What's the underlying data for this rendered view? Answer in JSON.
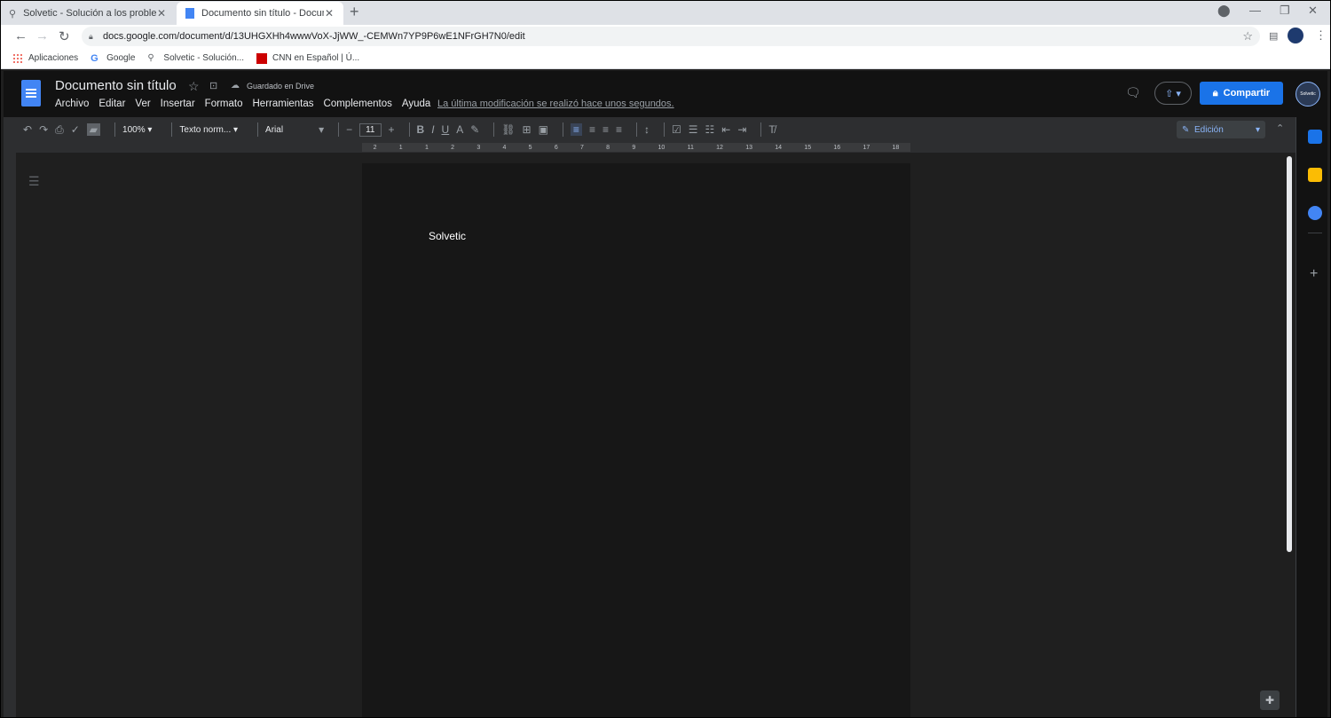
{
  "browser": {
    "tabs": [
      {
        "title": "Solvetic - Solución a los problem",
        "close": "✕"
      },
      {
        "title": "Documento sin título - Documen",
        "close": "✕"
      }
    ],
    "new_tab": "+",
    "url": "docs.google.com/document/d/13UHGXHh4wwwVoX-JjWW_-CEMWn7YP9P6wE1NFrGH7N0/edit",
    "bookmarks": [
      "Aplicaciones",
      "Google",
      "Solvetic - Solución...",
      "CNN en Español | Ú..."
    ]
  },
  "docs": {
    "title": "Documento sin título",
    "saved_status": "Guardado en Drive",
    "menus": [
      "Archivo",
      "Editar",
      "Ver",
      "Insertar",
      "Formato",
      "Herramientas",
      "Complementos",
      "Ayuda"
    ],
    "last_modified": "La última modificación se realizó hace unos segundos.",
    "share_label": "Compartir",
    "avatar_text": "Solvetic",
    "toolbar": {
      "zoom": "100%",
      "style": "Texto norm...",
      "font": "Arial",
      "font_size": "11",
      "mode": "Edición"
    },
    "ruler_marks": [
      "2",
      "1",
      "1",
      "2",
      "3",
      "4",
      "5",
      "6",
      "7",
      "8",
      "9",
      "10",
      "11",
      "12",
      "13",
      "14",
      "15",
      "16",
      "17",
      "18"
    ],
    "body_text": "Solvetic"
  },
  "colors": {
    "accent": "#1a73e8",
    "page_bg": "#171717",
    "canvas_bg": "#1f1f1f",
    "header_bg": "#121212"
  }
}
